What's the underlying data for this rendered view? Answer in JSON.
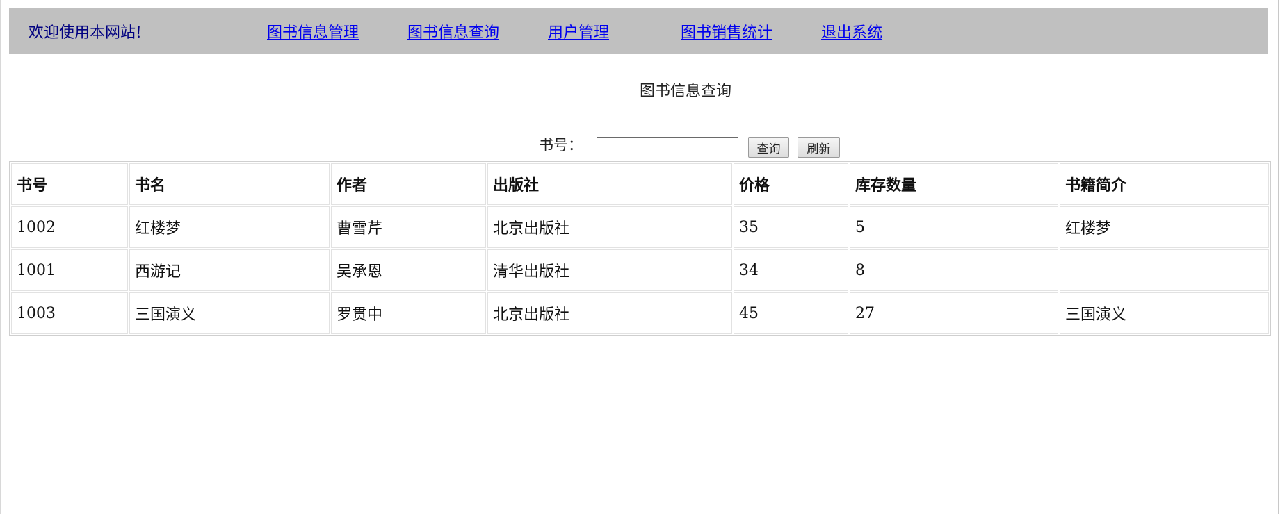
{
  "header": {
    "welcome": "欢迎使用本网站!",
    "nav": [
      {
        "label": "图书信息管理"
      },
      {
        "label": "图书信息查询"
      },
      {
        "label": "用户管理"
      },
      {
        "label": "图书销售统计"
      },
      {
        "label": "退出系统"
      }
    ]
  },
  "main": {
    "title": "图书信息查询",
    "search": {
      "label": "书号：",
      "value": "",
      "placeholder": "",
      "search_button": "查询",
      "refresh_button": "刷新"
    },
    "table": {
      "columns": [
        "书号",
        "书名",
        "作者",
        "出版社",
        "价格",
        "库存数量",
        "书籍简介"
      ],
      "rows": [
        [
          "1002",
          "红楼梦",
          "曹雪芹",
          "北京出版社",
          "35",
          "5",
          "红楼梦"
        ],
        [
          "1001",
          "西游记",
          "吴承恩",
          "清华出版社",
          "34",
          "8",
          ""
        ],
        [
          "1003",
          "三国演义",
          "罗贯中",
          "北京出版社",
          "45",
          "27",
          "三国演义"
        ]
      ]
    }
  },
  "colors": {
    "header_bg": "#c0c0c0",
    "link": "#0000ee",
    "welcome_text": "#000080"
  }
}
